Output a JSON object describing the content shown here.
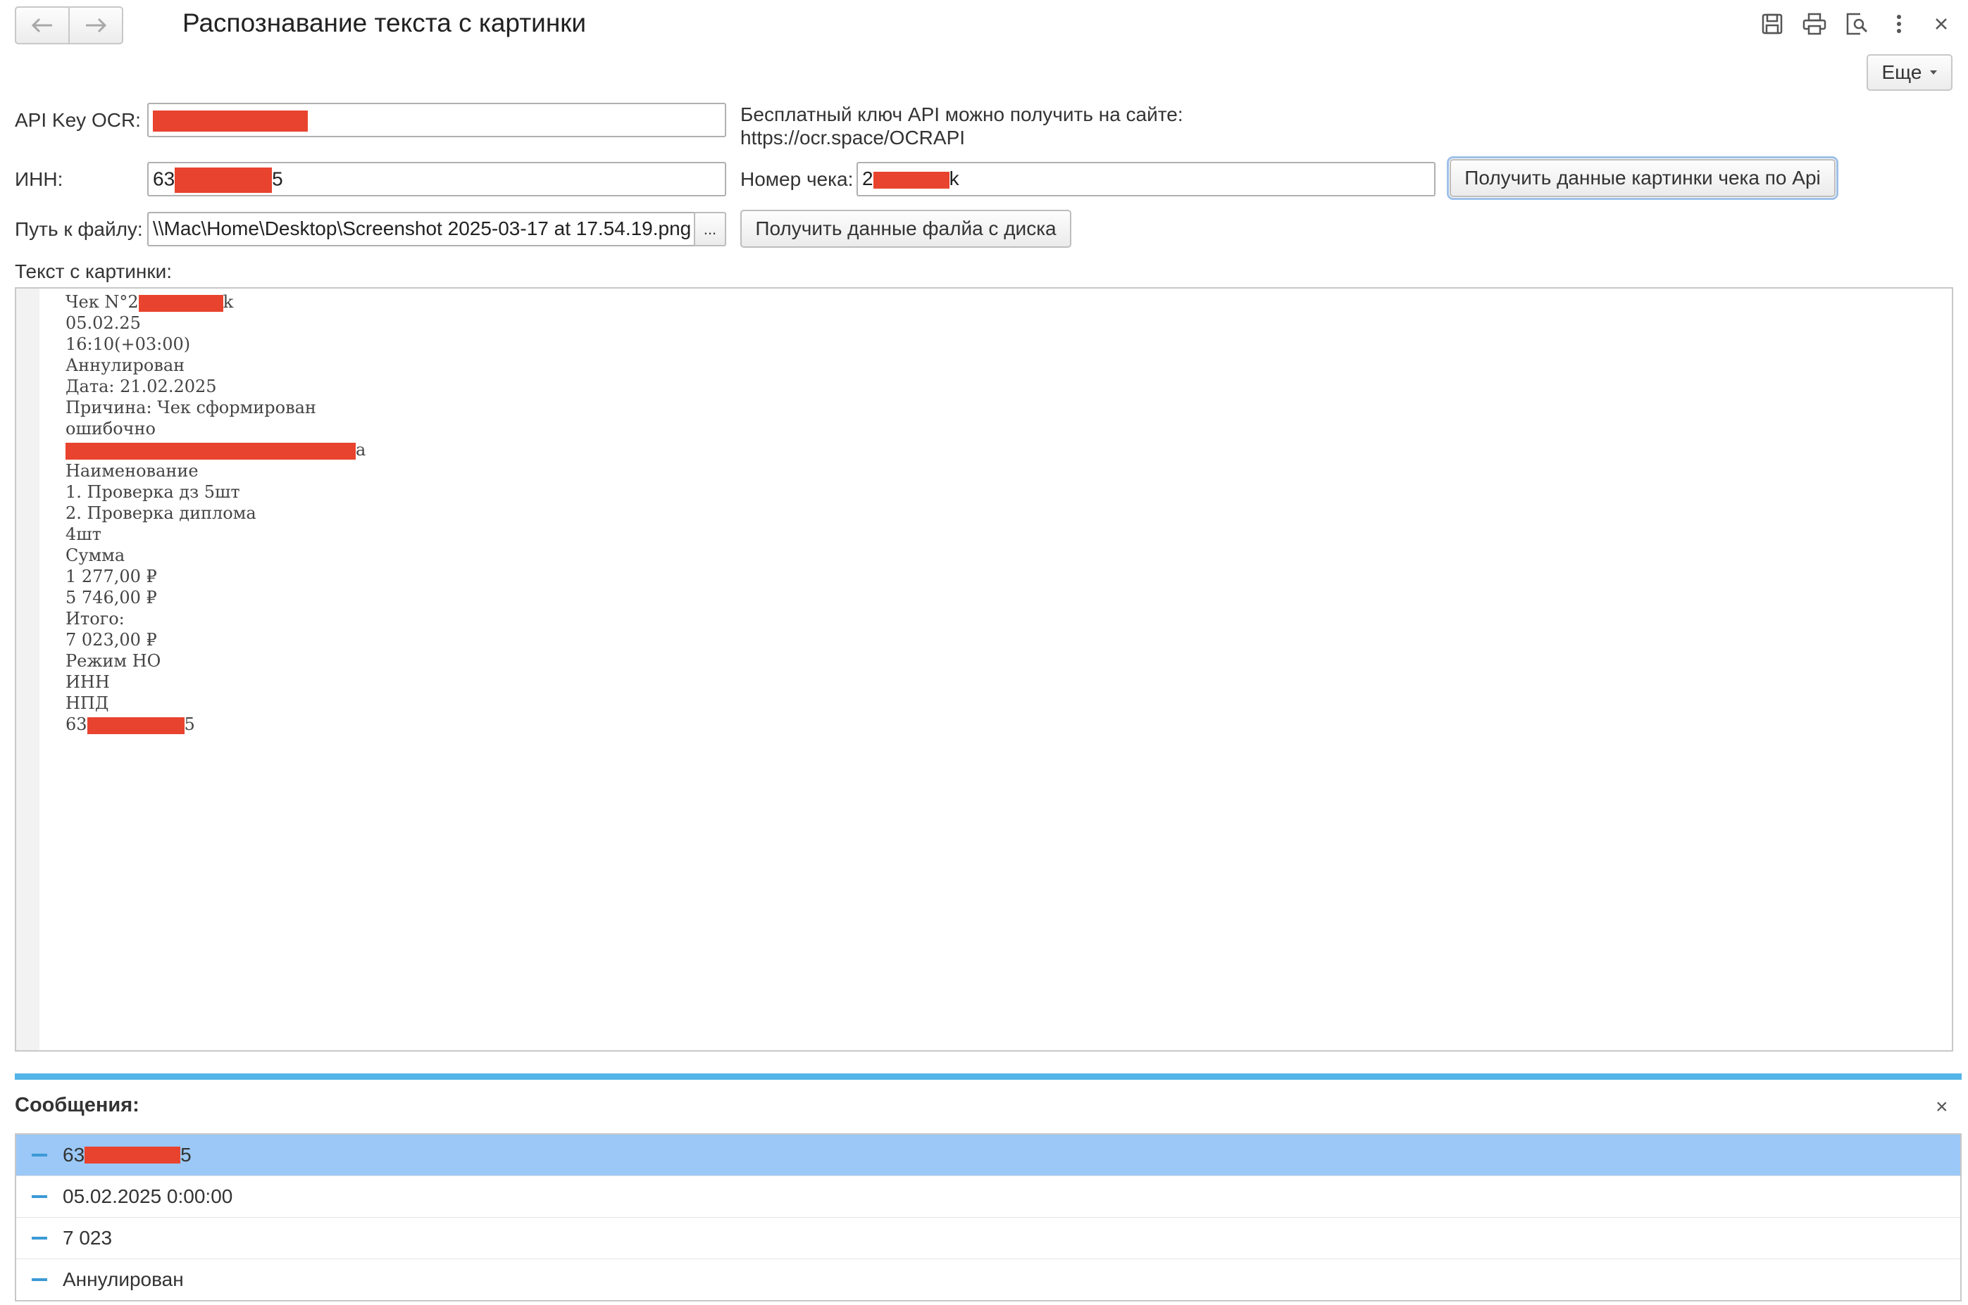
{
  "window": {
    "title": "Распознавание текста с картинки",
    "back_icon": "arrow-left",
    "forward_icon": "arrow-right",
    "toolbar_icons": [
      "save-icon",
      "print-icon",
      "preview-icon",
      "more-vertical-icon",
      "close-icon"
    ],
    "more_label": "Еще"
  },
  "form": {
    "api_key_label": "API Key OCR:",
    "api_key_value": "",
    "api_hint_line1": "Бесплатный ключ API можно получить на сайте:",
    "api_hint_line2": "https://ocr.space/OCRAPI",
    "inn_label": "ИНН:",
    "inn_prefix": "63",
    "inn_suffix": "5",
    "receipt_label": "Номер чека:",
    "receipt_prefix": "2",
    "receipt_suffix": "k",
    "get_api_button": "Получить данные картинки чека по Api",
    "path_label": "Путь к файлу:",
    "path_value": "\\\\Mac\\Home\\Desktop\\Screenshot 2025-03-17 at 17.54.19.png",
    "browse_label": "...",
    "get_disk_button": "Получить данные фалйа с диска",
    "text_label": "Текст с картинки:"
  },
  "ocr_text": {
    "line1_prefix": "Чек N°2",
    "line1_suffix": "k",
    "lines_a": [
      "05.02.25",
      "16:10(+03:00)",
      "Аннулирован",
      "Дата: 21.02.2025",
      "Причина: Чек сформирован",
      "ошибочно"
    ],
    "line8_suffix": "a",
    "lines_b": [
      "Наименование",
      "1. Проверка дз 5шт",
      "2. Проверка диплома",
      "4шт",
      "Сумма",
      "1 277,00 ₽",
      "5 746,00 ₽",
      "Итого:",
      "7 023,00 ₽",
      "Режим НО",
      "ИНН",
      "НПД"
    ],
    "last_prefix": "63",
    "last_suffix": "5"
  },
  "messages": {
    "title": "Сообщения:",
    "close_label": "×",
    "item0_prefix": "63",
    "item0_suffix": "5",
    "items": [
      "05.02.2025 0:00:00",
      "7 023",
      "Аннулирован"
    ]
  },
  "colors": {
    "accent": "#55b4e8",
    "selection": "#9bc8f7",
    "redaction": "#e8432e"
  }
}
